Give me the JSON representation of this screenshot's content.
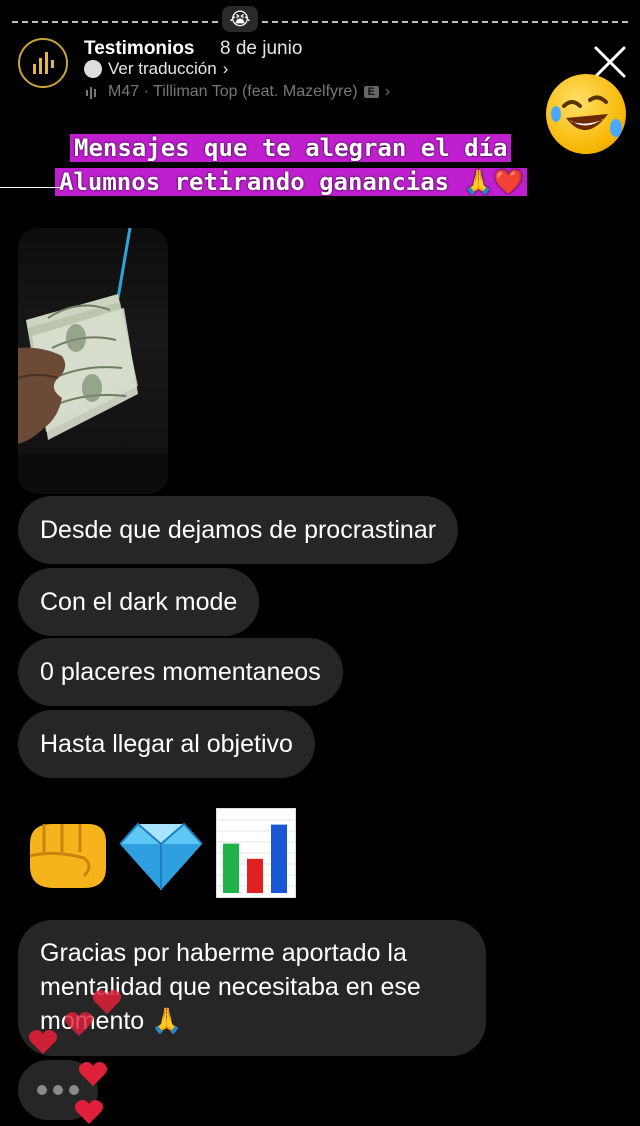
{
  "header": {
    "username": "Testimonios",
    "date": "8 de junio",
    "translate_label": "Ver traducción",
    "music_track": "M47 · Tilliman Top (feat. Mazelfyre)",
    "explicit_badge": "E",
    "top_emoji": "😭"
  },
  "captions": {
    "line1": "Mensajes que te alegran el día",
    "line2": "Alumnos retirando ganancias 🙏❤️"
  },
  "messages": [
    "Desde que dejamos de procrastinar",
    "Con el dark mode",
    "0 placeres momentaneos",
    "Hasta llegar al objetivo"
  ],
  "emoji_row": {
    "fist": "👊",
    "gem": "💎",
    "chart_bars": [
      {
        "color": "#1fb24a",
        "value": 0.65
      },
      {
        "color": "#e0201f",
        "value": 0.45
      },
      {
        "color": "#1b56d6",
        "value": 0.9
      }
    ]
  },
  "final_message": {
    "line1": "Gracias por haberme aportado la",
    "line2": "mentalidad que necesitaba en ese",
    "line3": "momento 🙏"
  },
  "colors": {
    "caption_highlight": "#bf1fcf",
    "bubble_bg": "#262626",
    "heart": "#e0203a"
  }
}
